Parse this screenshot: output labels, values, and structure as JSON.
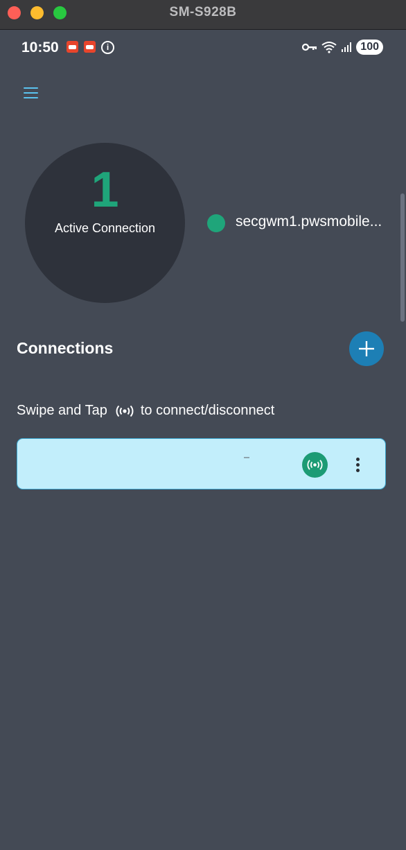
{
  "window": {
    "title": "SM-S928B"
  },
  "status_bar": {
    "time": "10:50",
    "battery": "100",
    "icons": [
      "app-notification-icon",
      "app-notification-icon",
      "info-icon",
      "vpn-key-icon",
      "wifi-icon",
      "signal-icon"
    ]
  },
  "colors": {
    "background": "#444a55",
    "circle": "#2e323b",
    "accent_green": "#1fa57a",
    "accent_blue": "#1d7fb5",
    "card": "#c2eefb"
  },
  "summary": {
    "count": "1",
    "label": "Active Connection",
    "active_host": "secgwm1.pwsmobile..."
  },
  "connections": {
    "title": "Connections",
    "hint_before": "Swipe and Tap",
    "hint_after": "to connect/disconnect",
    "items": [
      {
        "name": ""
      }
    ]
  }
}
